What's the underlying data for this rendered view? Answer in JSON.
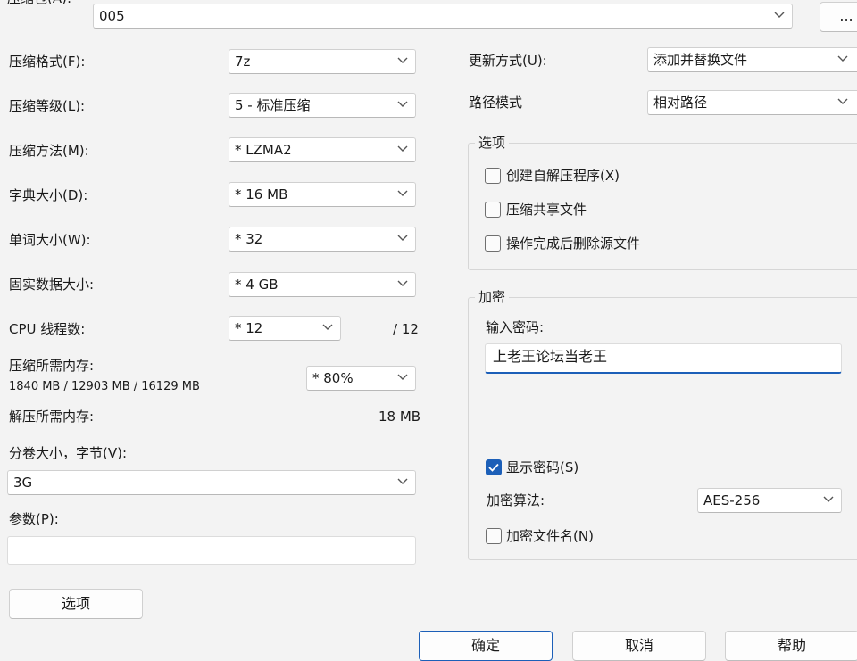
{
  "archive": {
    "label": "压缩包(A):",
    "value": "005",
    "browse_label": "..."
  },
  "left": {
    "format": {
      "label": "压缩格式(F):",
      "value": "7z"
    },
    "level": {
      "label": "压缩等级(L):",
      "value": "5 - 标准压缩"
    },
    "method": {
      "label": "压缩方法(M):",
      "value": "* LZMA2"
    },
    "dict": {
      "label": "字典大小(D):",
      "value": "* 16 MB"
    },
    "word": {
      "label": "单词大小(W):",
      "value": "* 32"
    },
    "solid": {
      "label": "固实数据大小:",
      "value": "* 4 GB"
    },
    "threads": {
      "label": "CPU 线程数:",
      "value": "* 12",
      "max": "/ 12"
    },
    "memory": {
      "label": "压缩所需内存:",
      "detail": "1840 MB / 12903 MB / 16129 MB",
      "value": "* 80%"
    },
    "decompress": {
      "label": "解压所需内存:",
      "value": "18 MB"
    },
    "volume": {
      "label": "分卷大小，字节(V):",
      "value": "3G"
    },
    "params": {
      "label": "参数(P):",
      "value": ""
    },
    "options_button": "选项"
  },
  "right": {
    "update": {
      "label": "更新方式(U):",
      "value": "添加并替换文件"
    },
    "path": {
      "label": "路径模式",
      "value": "相对路径"
    },
    "options": {
      "title": "选项",
      "items": [
        {
          "label": "创建自解压程序(X)",
          "checked": false
        },
        {
          "label": "压缩共享文件",
          "checked": false
        },
        {
          "label": "操作完成后删除源文件",
          "checked": false
        }
      ]
    },
    "encrypt": {
      "title": "加密",
      "password_label": "输入密码:",
      "password_value": "上老王论坛当老王",
      "show_password": {
        "label": "显示密码(S)",
        "checked": true
      },
      "method_label": "加密算法:",
      "method_value": "AES-256",
      "encrypt_names": {
        "label": "加密文件名(N)",
        "checked": false
      }
    }
  },
  "buttons": {
    "ok": "确定",
    "cancel": "取消",
    "help": "帮助"
  },
  "colors": {
    "accent": "#1c5fb8",
    "background": "#f3f3f3"
  }
}
